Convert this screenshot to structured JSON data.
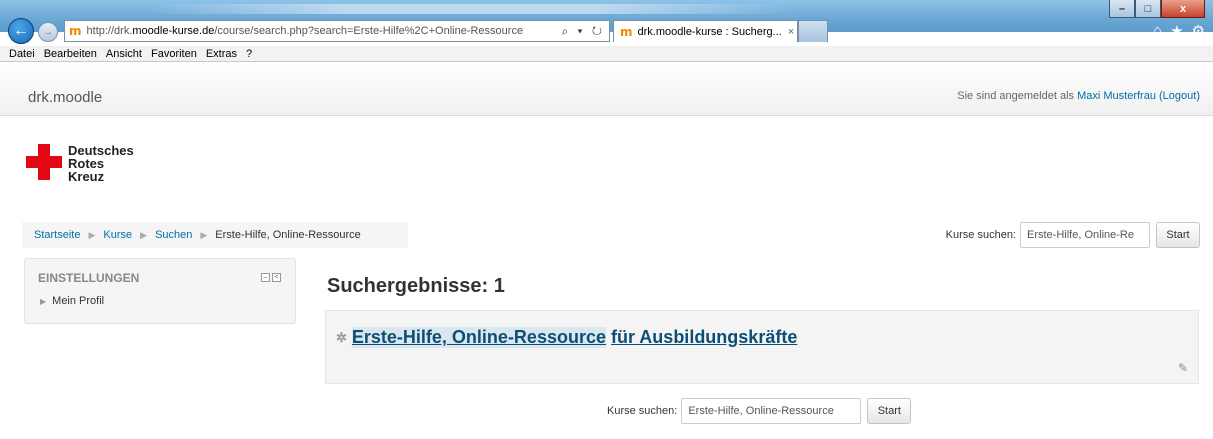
{
  "browser": {
    "url_prefix": "http://drk.",
    "url_domain": "moodle-kurse.de",
    "url_path": "/course/search.php?search=Erste-Hilfe%2C+Online-Ressource",
    "address_tools": "⌕ ▾ ↻",
    "tab_title": "drk.moodle-kurse : Sucherg...",
    "tab_close": "×",
    "favicon": "m",
    "home_icon": "⌂",
    "star_icon": "★",
    "gear_icon": "⚙",
    "win_min": "–",
    "win_max": "□",
    "win_close": "x",
    "back_glyph": "←",
    "fwd_glyph": "→",
    "menu": [
      "Datei",
      "Bearbeiten",
      "Ansicht",
      "Favoriten",
      "Extras",
      "?"
    ]
  },
  "header": {
    "site_name": "drk.moodle",
    "login_prefix": "Sie sind angemeldet als",
    "user_name": "Maxi Musterfrau",
    "logout": "(Logout)"
  },
  "logo": {
    "line1": "Deutsches",
    "line2": "Rotes",
    "line3": "Kreuz",
    "cross_color": "#e30613"
  },
  "breadcrumb": {
    "items": [
      "Startseite",
      "Kurse",
      "Suchen"
    ],
    "current": "Erste-Hilfe, Online-Ressource",
    "separator": "▶"
  },
  "top_search": {
    "label": "Kurse suchen:",
    "value": "Erste-Hilfe, Online-Re",
    "button": "Start"
  },
  "settings_block": {
    "title": "EINSTELLUNGEN",
    "collapse": "–",
    "dock": "<",
    "item": "Mein Profil",
    "item_marker": "▶"
  },
  "results": {
    "heading": "Suchergebnisse: 1",
    "course_icon": "✲",
    "course_highlight": "Erste-Hilfe, Online-Ressource",
    "course_rest": "für Ausbildungskräfte",
    "edit_icon": "✎"
  },
  "bottom_search": {
    "label": "Kurse suchen:",
    "value": "Erste-Hilfe, Online-Ressource",
    "button": "Start"
  },
  "colors": {
    "link": "#0070a8",
    "course_link": "#0b4f76"
  }
}
